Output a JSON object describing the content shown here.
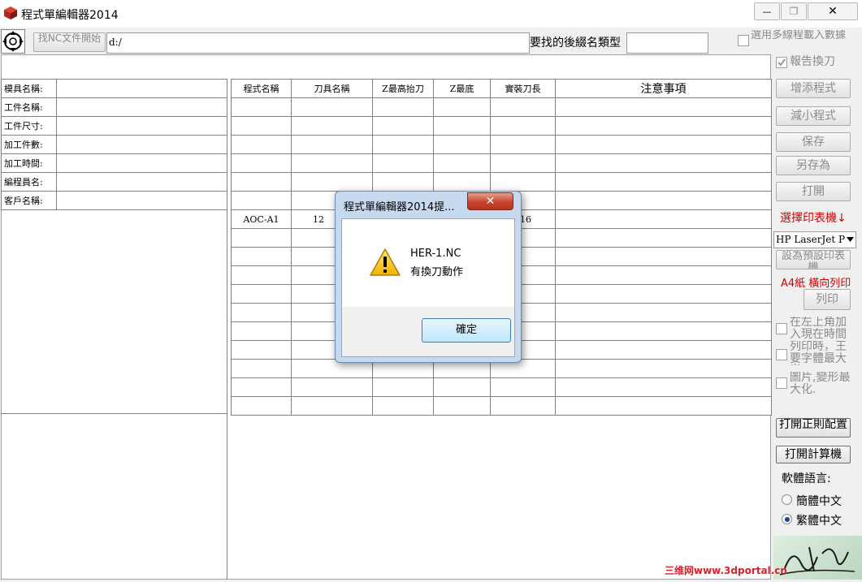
{
  "window": {
    "title": "程式單編輯器2014",
    "minimize_glyph": "—",
    "restore_glyph": "❐",
    "close_glyph": "✕"
  },
  "toolbar": {
    "find_button_label": "找NC文件開始",
    "path_value": "d:/",
    "suffix_label": "要找的後綴名類型",
    "suffix_value": "",
    "multi_task_label": "選用多線程載入數據"
  },
  "info_panel": {
    "labels": [
      "模具名稱:",
      "工件名稱:",
      "工件尺寸:",
      "加工件數:",
      "加工時間:",
      "編程員名:",
      "客戶名稱:"
    ],
    "values": [
      "",
      "",
      "",
      "",
      "",
      "",
      ""
    ]
  },
  "program_table": {
    "headers": [
      "程式名稱",
      "刀具名稱",
      "Z最高抬刀",
      "Z最底",
      "實裝刀長",
      "注意事項"
    ],
    "rows": [
      [
        "",
        "",
        "",
        "",
        "",
        ""
      ],
      [
        "",
        "",
        "",
        "",
        "",
        ""
      ],
      [
        "",
        "",
        "",
        "",
        "",
        ""
      ],
      [
        "",
        "",
        "",
        "",
        "",
        ""
      ],
      [
        "",
        "",
        "",
        "",
        "",
        ""
      ],
      [
        "",
        "",
        "",
        "",
        "",
        ""
      ],
      [
        "AOC-A1",
        "12",
        "",
        "",
        "16",
        ""
      ],
      [
        "",
        "",
        "",
        "",
        "",
        ""
      ],
      [
        "",
        "",
        "",
        "",
        "",
        ""
      ],
      [
        "",
        "",
        "",
        "",
        "",
        ""
      ],
      [
        "",
        "",
        "",
        "",
        "",
        ""
      ],
      [
        "",
        "",
        "",
        "",
        "",
        ""
      ],
      [
        "",
        "",
        "",
        "",
        "",
        ""
      ],
      [
        "",
        "",
        "",
        "",
        "",
        ""
      ],
      [
        "",
        "",
        "",
        "",
        "",
        ""
      ],
      [
        "",
        "",
        "",
        "",
        "",
        ""
      ],
      [
        "",
        "",
        "",
        "",
        "",
        ""
      ]
    ]
  },
  "sidebar": {
    "report_tool_change": "報告換刀",
    "add_program": "增添程式",
    "reduce_program": "減小程式",
    "save": "保存",
    "save_as": "另存為",
    "open": "打開",
    "select_printer_label": "選擇印表機↓",
    "printer_value": "HP LaserJet P",
    "set_default_printer": "設為預設印表機",
    "paper_label": "A4紙 橫向列印",
    "print": "列印",
    "opt_time_label": "在左上角加入現在時間",
    "opt_font_label": "列印時，王要字體最大光",
    "opt_image_label": "圖片,變形最大化.",
    "open_regex": "打開正則配置",
    "open_calculator": "打開計算機",
    "language_label": "軟體語言:",
    "lang_simplified": "簡體中文",
    "lang_traditional": "繁體中文",
    "selected_language": "繁體中文"
  },
  "dialog": {
    "title": "程式單編輯器2014提...",
    "close_glyph": "✕",
    "message_line1": "HER-1.NC",
    "message_line2": "有換刀動作",
    "ok_label": "確定"
  },
  "watermark": {
    "text": "三维网www.3dportal.cn"
  },
  "colors": {
    "red_label": "#d00000",
    "dialog_frame": "#c6d9ef",
    "close_button": "#c8432c",
    "watermark": "#d4232e"
  }
}
